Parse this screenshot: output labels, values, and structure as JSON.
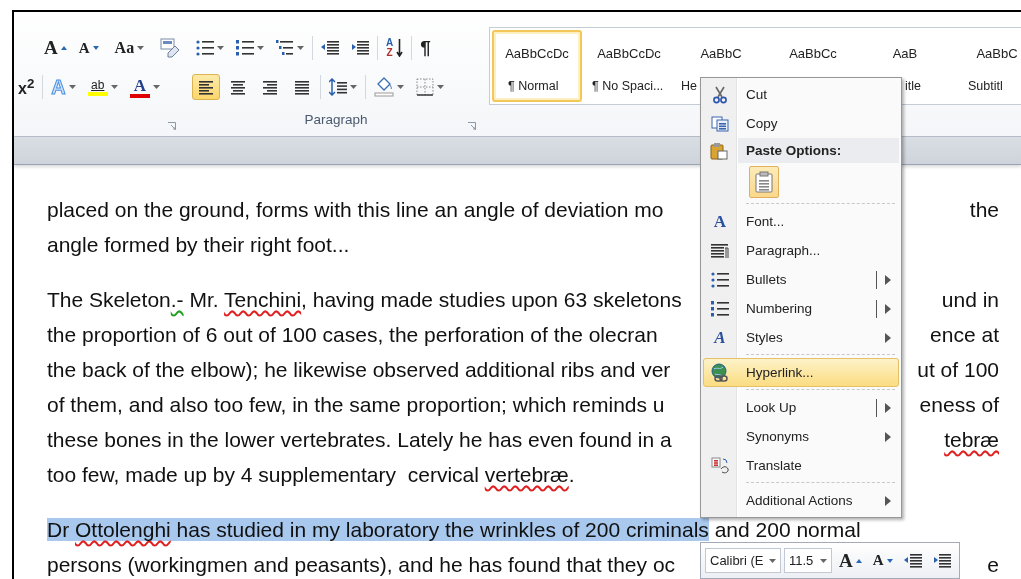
{
  "ribbon": {
    "font_group": {
      "grow_font": "A",
      "shrink_font": "A",
      "change_case": "Aa",
      "superscript": "x$^{2}$",
      "text_effects": "A",
      "highlight": "ab",
      "font_color": "A"
    },
    "paragraph_group": {
      "label": "Paragraph",
      "sort_letters": [
        "A",
        "Z"
      ],
      "show_marks": "¶",
      "alignment_buttons": [
        {
          "selected": true
        },
        {
          "selected": false
        },
        {
          "selected": false
        },
        {
          "selected": false
        }
      ]
    },
    "styles": [
      {
        "kind": "normal",
        "sample": "AaBbCcDc",
        "label": "¶ Normal",
        "selected": true
      },
      {
        "kind": "no-spacing",
        "sample": "AaBbCcDc",
        "label": "¶ No Spaci...",
        "selected": false
      },
      {
        "kind": "heading1",
        "sample": "AaBbC",
        "label": "He",
        "selected": false
      },
      {
        "kind": "heading2",
        "sample": "AaBbCc",
        "selected": false
      },
      {
        "kind": "title",
        "sample": "AaB",
        "label": "itle",
        "selected": false
      },
      {
        "kind": "subtitle",
        "sample": "AaBbC",
        "label": "Subtitl",
        "selected": false
      }
    ]
  },
  "document": {
    "paragraphs": [
      {
        "lines": [
          {
            "left": [
              {
                "text": "placed on the ground, forms with this line an angle of deviation mo",
                "kind": "plain"
              }
            ],
            "right": [
              {
                "text": "the",
                "kind": "plain"
              }
            ]
          },
          {
            "left": [
              {
                "text": "angle formed by their right foot...",
                "kind": "plain"
              }
            ]
          }
        ]
      },
      {
        "lines": [
          {
            "left": [
              {
                "text": "The Skeleton",
                "kind": "plain"
              },
              {
                "text": ".-",
                "kind": "grammar"
              },
              {
                "text": " Mr. ",
                "kind": "plain"
              },
              {
                "text": "Tenchini",
                "kind": "spelling"
              },
              {
                "text": ", having made studies upon 63 skeletons",
                "kind": "plain"
              }
            ],
            "right": [
              {
                "text": "und in",
                "kind": "plain"
              }
            ]
          },
          {
            "left": [
              {
                "text": "the proportion of 6 out of 100 cases, the perforation of the olecran",
                "kind": "plain"
              }
            ],
            "right": [
              {
                "text": "ence at",
                "kind": "plain"
              }
            ]
          },
          {
            "left": [
              {
                "text": "the back of the elbow); he likewise observed additional ribs and ver",
                "kind": "plain"
              }
            ],
            "right": [
              {
                "text": "ut of 100",
                "kind": "plain"
              }
            ]
          },
          {
            "left": [
              {
                "text": "of them, and also too few, in the same proportion; which reminds u",
                "kind": "plain"
              }
            ],
            "right": [
              {
                "text": "eness of",
                "kind": "plain"
              }
            ]
          },
          {
            "left": [
              {
                "text": "these bones in the lower vertebrates. Lately he has even found in a",
                "kind": "plain"
              }
            ],
            "right": [
              {
                "text": "tebræ",
                "kind": "spelling"
              }
            ]
          },
          {
            "left": [
              {
                "text": "too few, made up by 4 supplementary  cervical ",
                "kind": "plain"
              },
              {
                "text": "vertebræ",
                "kind": "spelling"
              },
              {
                "text": ".",
                "kind": "plain"
              }
            ]
          }
        ]
      },
      {
        "lines": [
          {
            "left": [
              {
                "text": "Dr ",
                "kind": "selected"
              },
              {
                "text": "Ottolenghi",
                "kind": "selected-spelling"
              },
              {
                "text": " has studied in my laboratory the wrinkles of 200 criminals",
                "kind": "selected"
              },
              {
                "text": " and 200 normal",
                "kind": "plain"
              }
            ]
          },
          {
            "left": [
              {
                "text": "persons (workingmen and peasants), and he has found that they oc",
                "kind": "plain"
              }
            ],
            "right": [
              {
                "text": "e",
                "kind": "plain"
              }
            ]
          }
        ]
      }
    ]
  },
  "context_menu": {
    "items": [
      {
        "kind": "item",
        "label": "Cut",
        "submenu": false,
        "split": false,
        "selected": false
      },
      {
        "kind": "item",
        "label": "Copy",
        "submenu": false,
        "split": false,
        "selected": false
      },
      {
        "kind": "header",
        "label": "Paste Options:"
      },
      {
        "kind": "paste"
      },
      {
        "kind": "separator"
      },
      {
        "kind": "item",
        "label": "Font...",
        "glyph": "A",
        "submenu": false,
        "split": false,
        "selected": false
      },
      {
        "kind": "item",
        "label": "Paragraph...",
        "submenu": false,
        "split": false,
        "selected": false
      },
      {
        "kind": "item",
        "label": "Bullets",
        "submenu": true,
        "split": true,
        "selected": false
      },
      {
        "kind": "item",
        "label": "Numbering",
        "submenu": true,
        "split": true,
        "selected": false
      },
      {
        "kind": "item",
        "label": "Styles",
        "glyph": "A",
        "submenu": true,
        "split": false,
        "selected": false
      },
      {
        "kind": "separator"
      },
      {
        "kind": "item",
        "label": "Hyperlink...",
        "submenu": false,
        "split": false,
        "selected": true
      },
      {
        "kind": "separator"
      },
      {
        "kind": "item",
        "label": "Look Up",
        "submenu": true,
        "split": true,
        "selected": false
      },
      {
        "kind": "item",
        "label": "Synonyms",
        "submenu": true,
        "split": false,
        "selected": false
      },
      {
        "kind": "item",
        "label": "Translate",
        "submenu": false,
        "split": false,
        "selected": false
      },
      {
        "kind": "separator"
      },
      {
        "kind": "item",
        "label": "Additional Actions",
        "submenu": true,
        "split": false,
        "selected": false
      }
    ]
  },
  "mini_toolbar": {
    "font_name": "Calibri (E",
    "font_size": "11.5",
    "grow_font": "A",
    "shrink_font": "A"
  }
}
